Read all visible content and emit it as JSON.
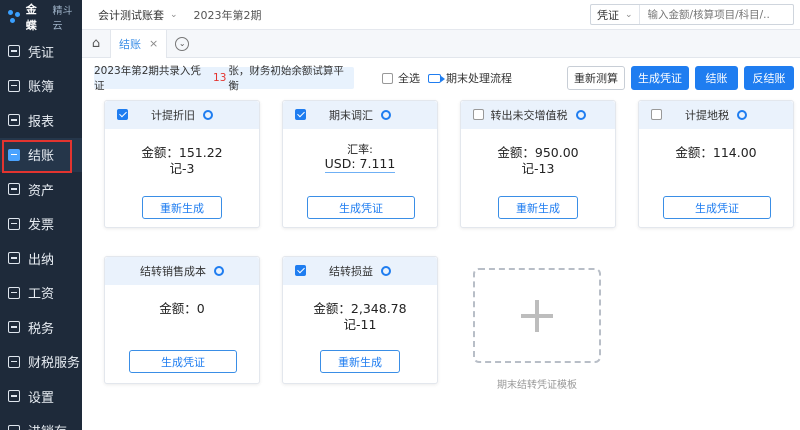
{
  "app": {
    "logo_text": "金蝶",
    "logo_sub": "精斗云"
  },
  "sidebar": {
    "items": [
      {
        "label": "凭证",
        "icon": "voucher-icon"
      },
      {
        "label": "账簿",
        "icon": "ledger-icon"
      },
      {
        "label": "报表",
        "icon": "report-icon"
      },
      {
        "label": "结账",
        "icon": "closing-icon",
        "active": true
      },
      {
        "label": "资产",
        "icon": "asset-icon"
      },
      {
        "label": "发票",
        "icon": "invoice-icon"
      },
      {
        "label": "出纳",
        "icon": "cashier-icon"
      },
      {
        "label": "工资",
        "icon": "salary-icon"
      },
      {
        "label": "税务",
        "icon": "tax-icon"
      },
      {
        "label": "财税服务",
        "icon": "service-icon"
      },
      {
        "label": "设置",
        "icon": "settings-icon"
      },
      {
        "label": "进销存",
        "icon": "inventory-icon"
      }
    ]
  },
  "header": {
    "book": "会计测试账套",
    "period": "2023年第2期",
    "search_type": "凭证",
    "search_placeholder": "输入金额/核算项目/科目/..."
  },
  "tabs": {
    "active_label": "结账"
  },
  "toolbar": {
    "notice_prefix": "2023年第2期共录入凭证",
    "notice_count": "13",
    "notice_suffix": "张，财务初始余额试算平衡",
    "select_all": "全选",
    "flow": "期末处理流程",
    "recalc": "重新测算",
    "generate": "生成凭证",
    "close": "结账",
    "reverse_close": "反结账"
  },
  "cards": [
    {
      "title": "计提折旧",
      "checked": true,
      "line1": "金额：151.22",
      "line2": "记-3",
      "button": "重新生成"
    },
    {
      "title": "期末调汇",
      "checked": true,
      "rate_label": "汇率:",
      "rate_value": "USD: 7.111",
      "button": "生成凭证"
    },
    {
      "title": "转出未交增值税",
      "checked": false,
      "line1": "金额：950.00",
      "line2": "记-13",
      "button": "重新生成"
    },
    {
      "title": "计提地税",
      "checked": false,
      "line1": "金额：114.00",
      "button": "生成凭证"
    },
    {
      "title": "结转销售成本",
      "checked": false,
      "line1": "金额：0",
      "button": "生成凭证"
    },
    {
      "title": "结转损益",
      "checked": true,
      "line1": "金额：2,348.78",
      "line2": "记-11",
      "button": "重新生成"
    }
  ],
  "add_template": {
    "label": "期末结转凭证模板"
  },
  "colors": {
    "accent": "#1f7df0",
    "sidebar_bg": "#1e2a3a",
    "highlight": "#e3342f"
  }
}
